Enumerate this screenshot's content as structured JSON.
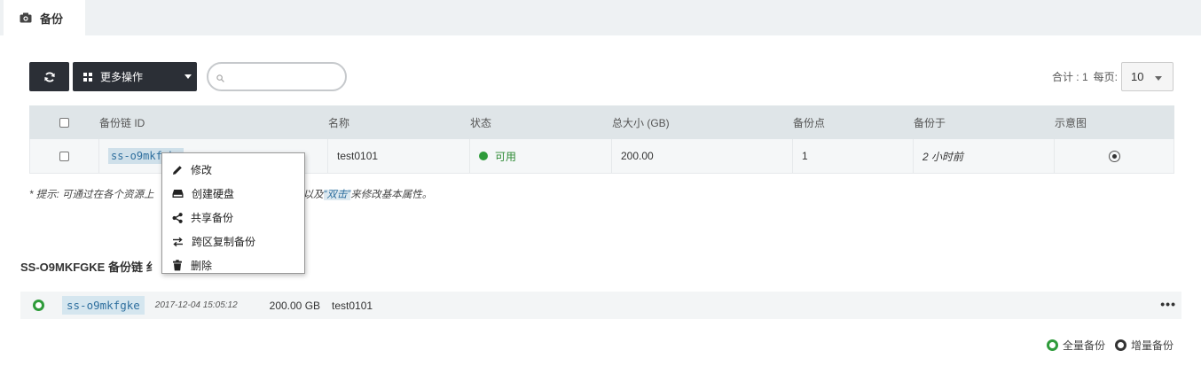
{
  "tab": {
    "label": "备份",
    "icon": "camera-icon"
  },
  "toolbar": {
    "refresh_icon": "refresh-icon",
    "more_label": "更多操作",
    "search_placeholder": ""
  },
  "pager": {
    "total": "合计 : 1",
    "per_page_label": "每页:",
    "per_page_value": "10"
  },
  "table": {
    "headers": [
      "",
      "备份链 ID",
      "名称",
      "状态",
      "总大小 (GB)",
      "备份点",
      "备份于",
      "示意图"
    ],
    "rows": [
      {
        "id": "ss-o9mkfgke",
        "name": "test0101",
        "status": "可用",
        "size": "200.00",
        "points": "1",
        "backup_at": "2 小时前"
      }
    ]
  },
  "hint": {
    "prefix": "* 提示:  可通过在各个资源上",
    "middle": "以及",
    "highlight": "“双击”",
    "suffix": "来修改基本属性。"
  },
  "context_menu": {
    "items": [
      {
        "label": "修改",
        "icon": "pencil-icon"
      },
      {
        "label": "创建硬盘",
        "icon": "disk-icon"
      },
      {
        "label": "共享备份",
        "icon": "share-icon"
      },
      {
        "label": "跨区复制备份",
        "icon": "swap-arrows-icon"
      },
      {
        "label": "删除",
        "icon": "trash-icon"
      }
    ]
  },
  "chain": {
    "title": "SS-O9MKFGKE 备份链 纟",
    "row": {
      "id": "ss-o9mkfgke",
      "timestamp": "2017-12-04 15:05:12",
      "size": "200.00 GB",
      "name": "test0101",
      "more": "•••"
    }
  },
  "legend": {
    "full": "全量备份",
    "incremental": "增量备份"
  },
  "colors": {
    "status_green": "#2e9b3a",
    "toolbar_dark": "#2b2f36",
    "link_blue": "#2e6f9e"
  }
}
